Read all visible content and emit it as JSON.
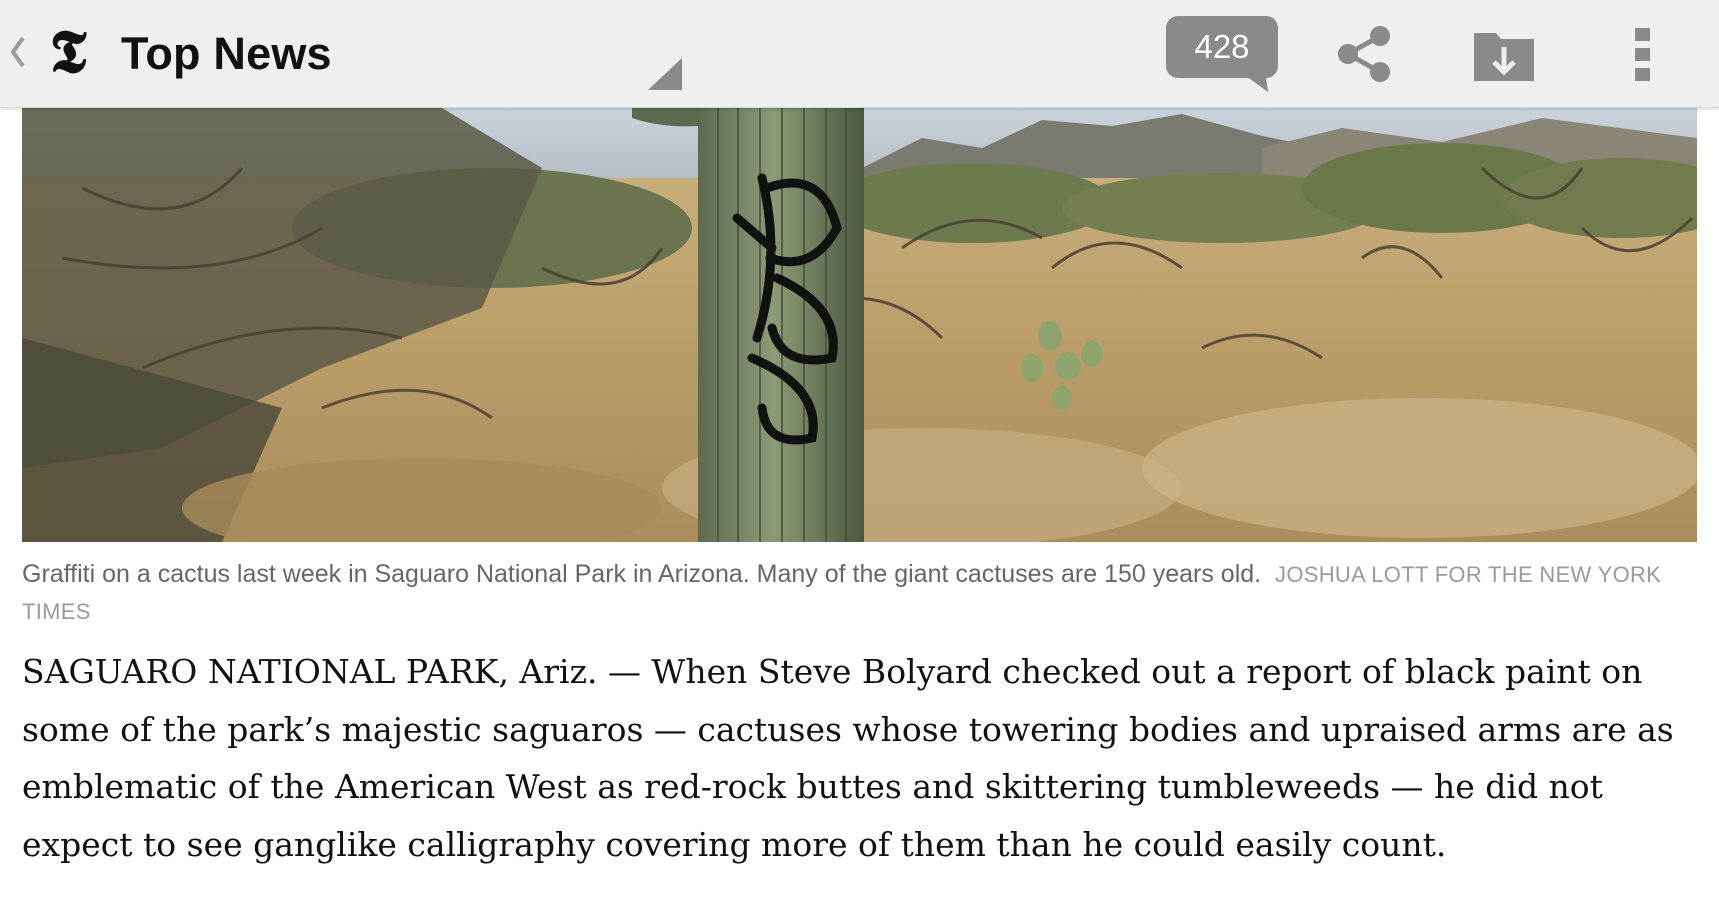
{
  "action_bar": {
    "logo_text": "𝕿",
    "section_title": "Top News",
    "comment_count": "428",
    "icons": [
      "back-chevron-icon",
      "nyt-logo-icon",
      "comment-bubble-icon",
      "share-icon",
      "save-download-icon",
      "overflow-menu-icon"
    ]
  },
  "article": {
    "caption": "Graffiti on a cactus last week in Saguaro National Park in Arizona. Many of the giant cactuses are 150 years old.",
    "credit": "JOSHUA LOTT FOR THE NEW YORK TIMES",
    "lead_paragraph": "SAGUARO NATIONAL PARK, Ariz. — When Steve Bolyard checked out a report of black paint on some of the park’s majestic saguaros — cactuses whose towering bodies and upraised arms are as emblematic of the American West as red-rock buttes and skittering tumbleweeds — he did not expect to see ganglike calligraphy covering more of them than he could easily count."
  },
  "colors": {
    "action_bar_bg": "#efefef",
    "icon_gray": "#8a8a8a",
    "caption_text": "#666666",
    "credit_text": "#9a9a9a",
    "body_text": "#111111"
  }
}
